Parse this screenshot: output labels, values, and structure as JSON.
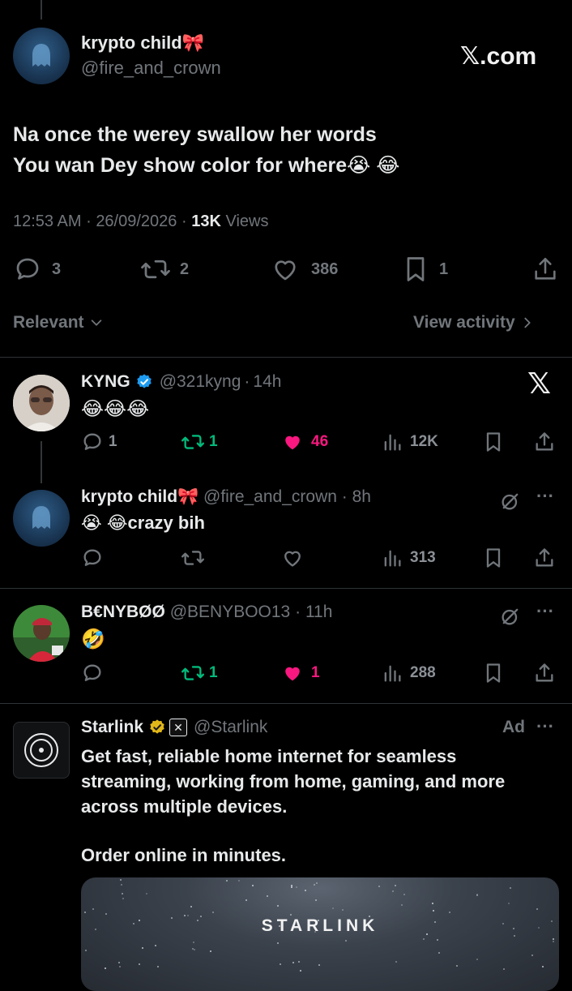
{
  "main_tweet": {
    "display_name": "krypto child🎀",
    "handle": "@fire_and_crown",
    "watermark": "𝕏.com",
    "text_line1": "Na once the werey swallow her words",
    "text_line2": "You wan Dey show color for where😭 😂",
    "time": "12:53 AM",
    "date": "26/09/2026",
    "views_count": "13K",
    "views_label": "Views",
    "replies": "3",
    "reposts": "2",
    "likes": "386",
    "bookmarks": "1"
  },
  "sort_bar": {
    "sort_label": "Relevant",
    "activity_label": "View activity"
  },
  "replies": [
    {
      "display_name": "KYNG",
      "handle": "@321kyng",
      "time": "14h",
      "text": "😂😂😂",
      "replies": "1",
      "reposts": "1",
      "likes": "46",
      "views": "12K",
      "liked": true
    },
    {
      "display_name": "krypto child🎀",
      "handle": "@fire_and_crown",
      "time": "8h",
      "text": "😭 😂crazy bih",
      "views": "313"
    },
    {
      "display_name": "B€NYBØØ",
      "handle": "@BENYBOO13",
      "time": "11h",
      "text": "🤣",
      "reposts": "1",
      "likes": "1",
      "views": "288",
      "liked": true
    }
  ],
  "ad": {
    "display_name": "Starlink",
    "handle": "@Starlink",
    "ad_label": "Ad",
    "line1": "Get fast, reliable home internet for seamless",
    "line2": "streaming, working from home, gaming, and more",
    "line3": "across multiple devices.",
    "line4": "Order online in minutes.",
    "card_brand": "STARLINK"
  },
  "colors": {
    "background": "#000000",
    "text": "#e7e9ea",
    "muted": "#71767b",
    "like_pink": "#f91880",
    "repost_green": "#00ba7c",
    "verified_blue": "#1d9bf0",
    "verified_gold": "#e2b719"
  }
}
